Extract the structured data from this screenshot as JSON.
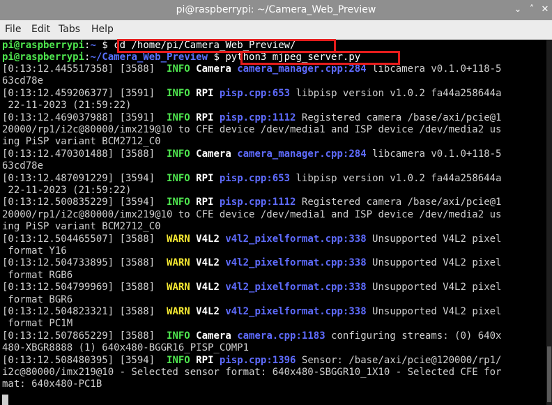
{
  "window": {
    "title": "pi@raspberrypi: ~/Camera_Web_Preview",
    "min_symbol": "⌄",
    "max_symbol": "˄",
    "close_symbol": "✕"
  },
  "menu": [
    "File",
    "Edit",
    "Tabs",
    "Help"
  ],
  "colors": {
    "titlebar": "#8f8f8f",
    "prompt_user": "#4ee54e",
    "prompt_path": "#5a73ff",
    "info": "#4ee54e",
    "warn": "#f4e832",
    "highlight_box": "#e51c1c"
  },
  "prompts": [
    {
      "user": "pi@raspberrypi",
      "sep": ":",
      "path": "~",
      "sym": " $ ",
      "cmd": "cd /home/pi/Camera_Web_Preview/"
    },
    {
      "user": "pi@raspberrypi",
      "sep": ":",
      "path": "~/Camera_Web_Preview",
      "sym": " $ ",
      "cmd": "python3 mjpeg_server.py"
    }
  ],
  "log": [
    {
      "pre": "[0:13:12.445517358] [3588]  ",
      "lvl": "INFO",
      "cat": "Camera",
      "src": "camera_manager.cpp:284",
      "msg": " libcamera v0.1.0+118-5"
    },
    {
      "text": "63cd78e"
    },
    {
      "pre": "[0:13:12.459206377] [3591]  ",
      "lvl": "INFO",
      "cat": "RPI",
      "src": "pisp.cpp:653",
      "msg": " libpisp version v1.0.2 fa44a258644a"
    },
    {
      "text": " 22-11-2023 (21:59:22)"
    },
    {
      "pre": "[0:13:12.469037988] [3591]  ",
      "lvl": "INFO",
      "cat": "RPI",
      "src": "pisp.cpp:1112",
      "msg": " Registered camera /base/axi/pcie@1"
    },
    {
      "text": "20000/rp1/i2c@80000/imx219@10 to CFE device /dev/media1 and ISP device /dev/media2 us"
    },
    {
      "text": "ing PiSP variant BCM2712_C0"
    },
    {
      "pre": "[0:13:12.470301488] [3588]  ",
      "lvl": "INFO",
      "cat": "Camera",
      "src": "camera_manager.cpp:284",
      "msg": " libcamera v0.1.0+118-5"
    },
    {
      "text": "63cd78e"
    },
    {
      "pre": "[0:13:12.487091229] [3594]  ",
      "lvl": "INFO",
      "cat": "RPI",
      "src": "pisp.cpp:653",
      "msg": " libpisp version v1.0.2 fa44a258644a"
    },
    {
      "text": " 22-11-2023 (21:59:22)"
    },
    {
      "pre": "[0:13:12.500835229] [3594]  ",
      "lvl": "INFO",
      "cat": "RPI",
      "src": "pisp.cpp:1112",
      "msg": " Registered camera /base/axi/pcie@1"
    },
    {
      "text": "20000/rp1/i2c@80000/imx219@10 to CFE device /dev/media1 and ISP device /dev/media2 us"
    },
    {
      "text": "ing PiSP variant BCM2712_C0"
    },
    {
      "pre": "[0:13:12.504465507] [3588]  ",
      "lvl": "WARN",
      "cat": "V4L2",
      "src": "v4l2_pixelformat.cpp:338",
      "msg": " Unsupported V4L2 pixel"
    },
    {
      "text": " format Y16"
    },
    {
      "pre": "[0:13:12.504733895] [3588]  ",
      "lvl": "WARN",
      "cat": "V4L2",
      "src": "v4l2_pixelformat.cpp:338",
      "msg": " Unsupported V4L2 pixel"
    },
    {
      "text": " format RGB6"
    },
    {
      "pre": "[0:13:12.504799969] [3588]  ",
      "lvl": "WARN",
      "cat": "V4L2",
      "src": "v4l2_pixelformat.cpp:338",
      "msg": " Unsupported V4L2 pixel"
    },
    {
      "text": " format BGR6"
    },
    {
      "pre": "[0:13:12.504823321] [3588]  ",
      "lvl": "WARN",
      "cat": "V4L2",
      "src": "v4l2_pixelformat.cpp:338",
      "msg": " Unsupported V4L2 pixel"
    },
    {
      "text": " format PC1M"
    },
    {
      "pre": "[0:13:12.507865229] [3588]  ",
      "lvl": "INFO",
      "cat": "Camera",
      "src": "camera.cpp:1183",
      "msg": " configuring streams: (0) 640x"
    },
    {
      "text": "480-XBGR8888 (1) 640x480-BGGR16_PISP_COMP1"
    },
    {
      "pre": "[0:13:12.508480395] [3594]  ",
      "lvl": "INFO",
      "cat": "RPI",
      "src": "pisp.cpp:1396",
      "msg": " Sensor: /base/axi/pcie@120000/rp1/"
    },
    {
      "text": "i2c@80000/imx219@10 - Selected sensor format: 640x480-SBGGR10_1X10 - Selected CFE for"
    },
    {
      "text": "mat: 640x480-PC1B"
    }
  ]
}
